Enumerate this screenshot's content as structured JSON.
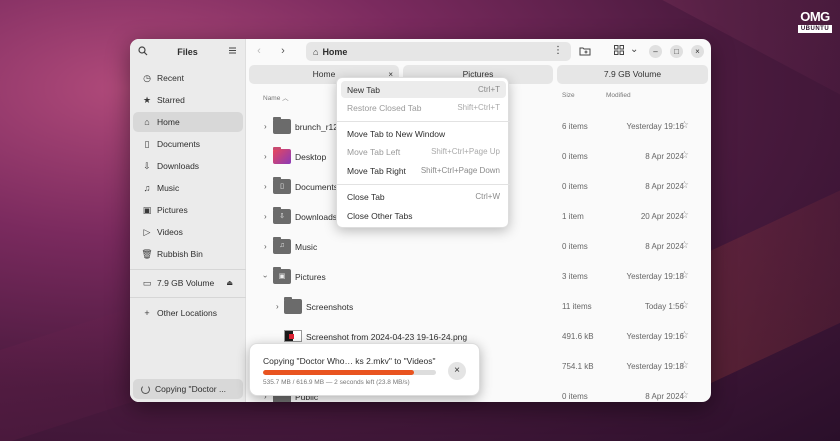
{
  "brand": {
    "line1": "OMG",
    "line2": "UBUNTU"
  },
  "sidebar": {
    "title": "Files",
    "items": [
      {
        "label": "Recent",
        "icon": "clock-icon"
      },
      {
        "label": "Starred",
        "icon": "star-icon"
      },
      {
        "label": "Home",
        "icon": "home-icon",
        "active": true
      },
      {
        "label": "Documents",
        "icon": "document-icon"
      },
      {
        "label": "Downloads",
        "icon": "download-icon"
      },
      {
        "label": "Music",
        "icon": "music-icon"
      },
      {
        "label": "Pictures",
        "icon": "picture-icon"
      },
      {
        "label": "Videos",
        "icon": "video-icon"
      },
      {
        "label": "Rubbish Bin",
        "icon": "trash-icon"
      }
    ],
    "volume": "7.9 GB Volume",
    "other": "Other Locations",
    "status": "Copying \"Doctor ..."
  },
  "toolbar": {
    "path": "Home"
  },
  "tabs": [
    {
      "label": "Home"
    },
    {
      "label": "Pictures"
    },
    {
      "label": "7.9 GB Volume"
    }
  ],
  "columns": {
    "name": "Name",
    "size": "Size",
    "modified": "Modified"
  },
  "files": [
    {
      "name": "brunch_r12",
      "size": "6 items",
      "modified": "Yesterday 19:16"
    },
    {
      "name": "Desktop",
      "size": "0 items",
      "modified": "8 Apr 2024"
    },
    {
      "name": "Documents",
      "size": "0 items",
      "modified": "8 Apr 2024"
    },
    {
      "name": "Downloads",
      "size": "1 item",
      "modified": "20 Apr 2024"
    },
    {
      "name": "Music",
      "size": "0 items",
      "modified": "8 Apr 2024"
    },
    {
      "name": "Pictures",
      "size": "3 items",
      "modified": "Yesterday 19:18"
    },
    {
      "name": "Screenshots",
      "size": "11 items",
      "modified": "Today 1:56"
    },
    {
      "name": "Screenshot from 2024-04-23 19-16-24.png",
      "size": "491.6 kB",
      "modified": "Yesterday 19:16"
    },
    {
      "name": "",
      "size": "754.1 kB",
      "modified": "Yesterday 19:18"
    },
    {
      "name": "Public",
      "size": "0 items",
      "modified": "8 Apr 2024"
    }
  ],
  "context_menu": [
    {
      "label": "New Tab",
      "shortcut": "Ctrl+T",
      "highlighted": true
    },
    {
      "label": "Restore Closed Tab",
      "shortcut": "Shift+Ctrl+T",
      "disabled": true
    },
    {
      "label": "Move Tab to New Window",
      "shortcut": ""
    },
    {
      "label": "Move Tab Left",
      "shortcut": "Shift+Ctrl+Page Up",
      "disabled": true
    },
    {
      "label": "Move Tab Right",
      "shortcut": "Shift+Ctrl+Page Down"
    },
    {
      "label": "Close Tab",
      "shortcut": "Ctrl+W"
    },
    {
      "label": "Close Other Tabs",
      "shortcut": ""
    }
  ],
  "copy_toast": {
    "title": "Copying \"Doctor Who… ks 2.mkv\" to \"Videos\"",
    "detail": "535.7 MB / 616.9 MB — 2 seconds left (23.8 MB/s)",
    "progress": 0.87,
    "accent": "#e95420"
  }
}
